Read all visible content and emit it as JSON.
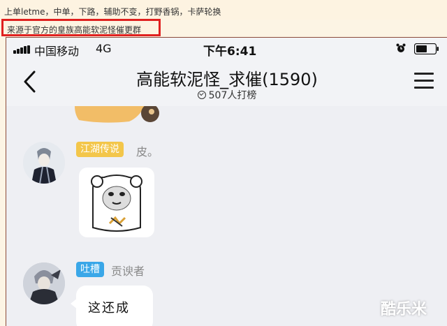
{
  "caption": {
    "line1": "上单letme，中单，下路，辅助不变，打野香锅，卡萨轮换",
    "line2": "来源于官方的皇族高能软泥怪催更群"
  },
  "status_bar": {
    "carrier": "中国移动",
    "network": "4G",
    "time": "下午6:41",
    "icons": [
      "signal-icon",
      "alarm-icon",
      "battery-icon"
    ]
  },
  "header": {
    "title": "高能软泥怪_求催(1590)",
    "rank_text": "507人打榜",
    "icons": [
      "back-icon",
      "rank-icon",
      "menu-icon"
    ]
  },
  "messages": [
    {
      "badge": "江湖传说",
      "badge_color": "#f3c64a",
      "sender": "皮。",
      "content_type": "sticker"
    },
    {
      "badge": "吐槽",
      "badge_color": "#3aa7e8",
      "sender": "贡谀者",
      "text": "这还成"
    }
  ],
  "watermark": "酷乐米"
}
